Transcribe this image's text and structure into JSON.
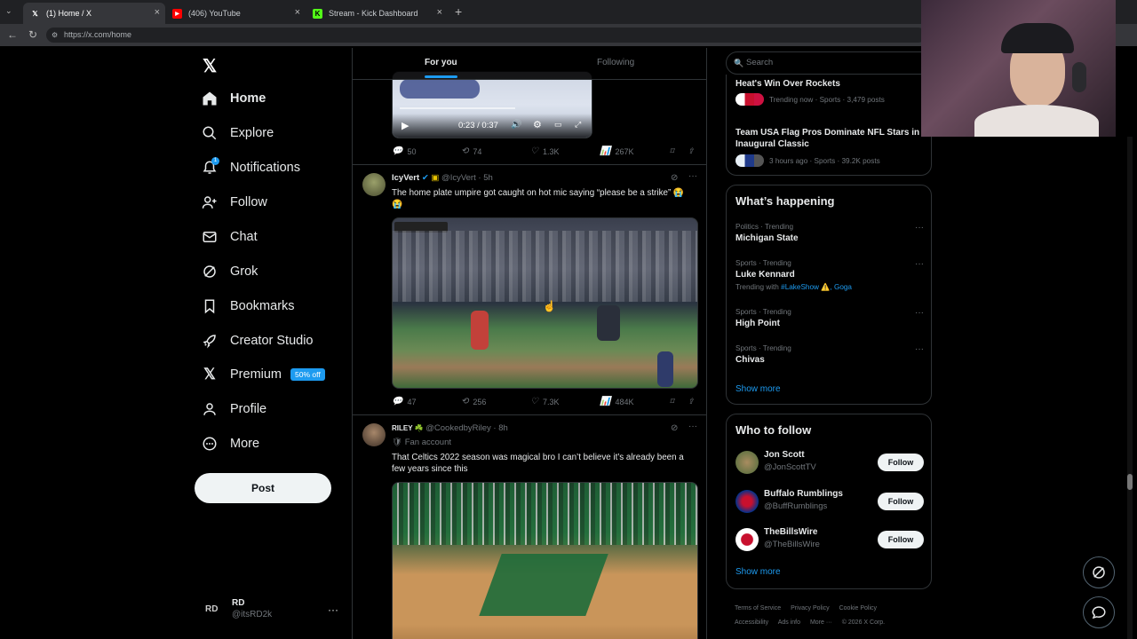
{
  "browser": {
    "tabs": [
      {
        "title": "(1) Home / X",
        "icon": "x-logo"
      },
      {
        "title": "(406) YouTube",
        "icon": "youtube-logo"
      },
      {
        "title": "Stream - Kick Dashboard",
        "icon": "kick-logo"
      }
    ],
    "url": "https://x.com/home"
  },
  "nav": {
    "items": [
      {
        "label": "Home",
        "icon": "home-icon"
      },
      {
        "label": "Explore",
        "icon": "search-icon"
      },
      {
        "label": "Notifications",
        "icon": "bell-icon",
        "badge": "1"
      },
      {
        "label": "Follow",
        "icon": "person-plus-icon"
      },
      {
        "label": "Chat",
        "icon": "mail-icon"
      },
      {
        "label": "Grok",
        "icon": "grok-icon"
      },
      {
        "label": "Bookmarks",
        "icon": "bookmark-icon"
      },
      {
        "label": "Creator Studio",
        "icon": "rocket-icon"
      },
      {
        "label": "Premium",
        "icon": "x-icon",
        "badge": "50% off"
      },
      {
        "label": "Profile",
        "icon": "person-icon"
      },
      {
        "label": "More",
        "icon": "more-circle-icon"
      }
    ],
    "post_label": "Post",
    "account": {
      "initials": "RD",
      "name": "RD",
      "handle": "@itsRD2k"
    }
  },
  "timeline": {
    "tabs": [
      "For you",
      "Following"
    ],
    "tweet0": {
      "video_time": "0:23 / 0:37",
      "stats": {
        "replies": "50",
        "reposts": "74",
        "likes": "1.3K",
        "views": "267K"
      }
    },
    "tweet1": {
      "name": "IcyVert",
      "handle": "@IcyVert",
      "time": "5h",
      "text": "The home plate umpire got caught on hot mic saying “please be a strike” 😭😭",
      "stats": {
        "replies": "47",
        "reposts": "256",
        "likes": "7.3K",
        "views": "484K"
      }
    },
    "tweet2": {
      "name": "RILEY ☘️",
      "handle": "@CookedbyRiley",
      "time": "8h",
      "label": "Fan account",
      "text": "That Celtics 2022 season was magical bro I can’t believe it’s already been a few years since this"
    }
  },
  "right": {
    "search_placeholder": "Search",
    "top_trends": [
      {
        "title": "Heat's Win Over Rockets",
        "meta": "Trending now · Sports · 3,479 posts"
      },
      {
        "title": "Team USA Flag Pros Dominate NFL Stars in Inaugural Classic",
        "meta": "3 hours ago · Sports · 39.2K posts"
      }
    ],
    "happening_title": "What’s happening",
    "trends": [
      {
        "cat": "Politics · Trending",
        "title": "Michigan State"
      },
      {
        "cat": "Sports · Trending",
        "title": "Luke Kennard",
        "extra": "Trending with",
        "tags": "#LakeShow ⚠️, Goga"
      },
      {
        "cat": "Sports · Trending",
        "title": "High Point"
      },
      {
        "cat": "Sports · Trending",
        "title": "Chivas"
      }
    ],
    "show_more": "Show more",
    "wtf_title": "Who to follow",
    "follow_label": "Follow",
    "wtf": [
      {
        "name": "Jon Scott",
        "handle": "@JonScottTV"
      },
      {
        "name": "Buffalo Rumblings",
        "handle": "@BuffRumblings"
      },
      {
        "name": "TheBillsWire",
        "handle": "@TheBillsWire"
      }
    ],
    "footer": [
      "Terms of Service",
      "Privacy Policy",
      "Cookie Policy",
      "Accessibility",
      "Ads info",
      "More ···",
      "© 2026 X Corp."
    ]
  }
}
